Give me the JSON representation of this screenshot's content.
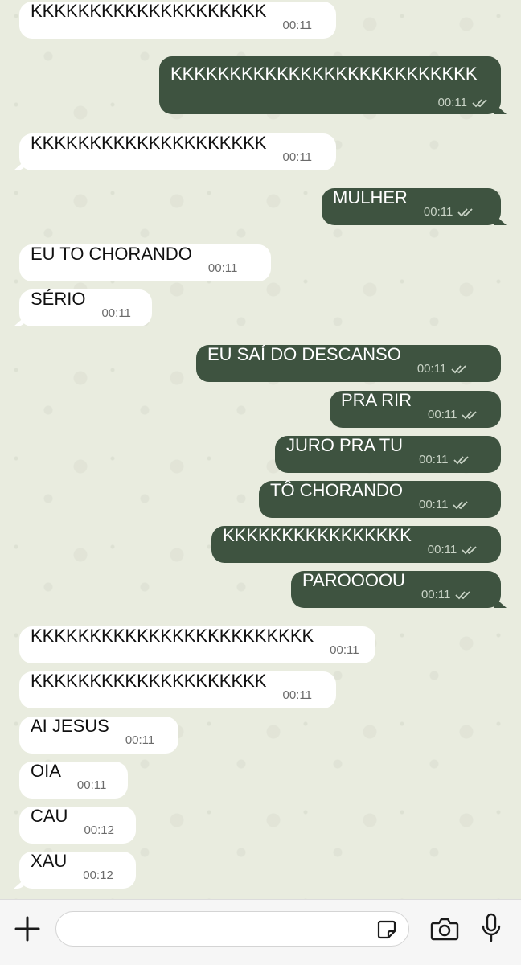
{
  "messages": [
    {
      "text": "KKKKKKKKKKKKKKKKKKKK",
      "time": "00:11"
    },
    {
      "text": "KKKKKKKKKKKKKKKKKKKKKKKKKK",
      "time": "00:11"
    },
    {
      "text": "KKKKKKKKKKKKKKKKKKKK",
      "time": "00:11"
    },
    {
      "text": "MULHER",
      "time": "00:11"
    },
    {
      "text": "EU TO CHORANDO",
      "time": "00:11"
    },
    {
      "text": "SÉRIO",
      "time": "00:11"
    },
    {
      "text": "EU SAÍ DO DESCANSO",
      "time": "00:11"
    },
    {
      "text": "PRA RIR",
      "time": "00:11"
    },
    {
      "text": "JURO PRA TU",
      "time": "00:11"
    },
    {
      "text": "TÔ CHORANDO",
      "time": "00:11"
    },
    {
      "text": "KKKKKKKKKKKKKKKK",
      "time": "00:11"
    },
    {
      "text": "PAROOOOU",
      "time": "00:11"
    },
    {
      "text": "KKKKKKKKKKKKKKKKKKKKKKKK",
      "time": "00:11"
    },
    {
      "text": "KKKKKKKKKKKKKKKKKKKK",
      "time": "00:11"
    },
    {
      "text": "AI JESUS",
      "time": "00:11"
    },
    {
      "text": "OIA",
      "time": "00:11"
    },
    {
      "text": "CAU",
      "time": "00:12"
    },
    {
      "text": "XAU",
      "time": "00:12"
    }
  ],
  "composer": {
    "placeholder": "",
    "value": ""
  },
  "icons": {
    "attach": "plus-icon",
    "sticker": "sticker-icon",
    "camera": "camera-icon",
    "mic": "microphone-icon",
    "read_receipt": "double-check-icon"
  },
  "colors": {
    "outgoing_bubble": "#3e5340",
    "incoming_bubble": "#ffffff",
    "chat_background": "#e9ecdf"
  }
}
